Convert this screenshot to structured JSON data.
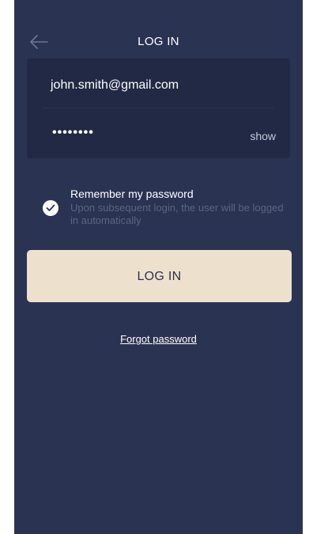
{
  "header": {
    "title": "LOG IN",
    "back_icon": "arrow-left-icon"
  },
  "form": {
    "email": "john.smith@gmail.com",
    "password_masked": "••••••••",
    "show_label": "show"
  },
  "remember": {
    "checked": true,
    "label": "Remember my password",
    "hint": "Upon subsequent login, the user will be logged in automatically"
  },
  "login_button": {
    "label": "LOG IN"
  },
  "forgot_link": "Forgot password",
  "colors": {
    "background": "#2b3352",
    "card": "#212945",
    "button": "#ede1cd",
    "hint_text": "#5b6485"
  }
}
